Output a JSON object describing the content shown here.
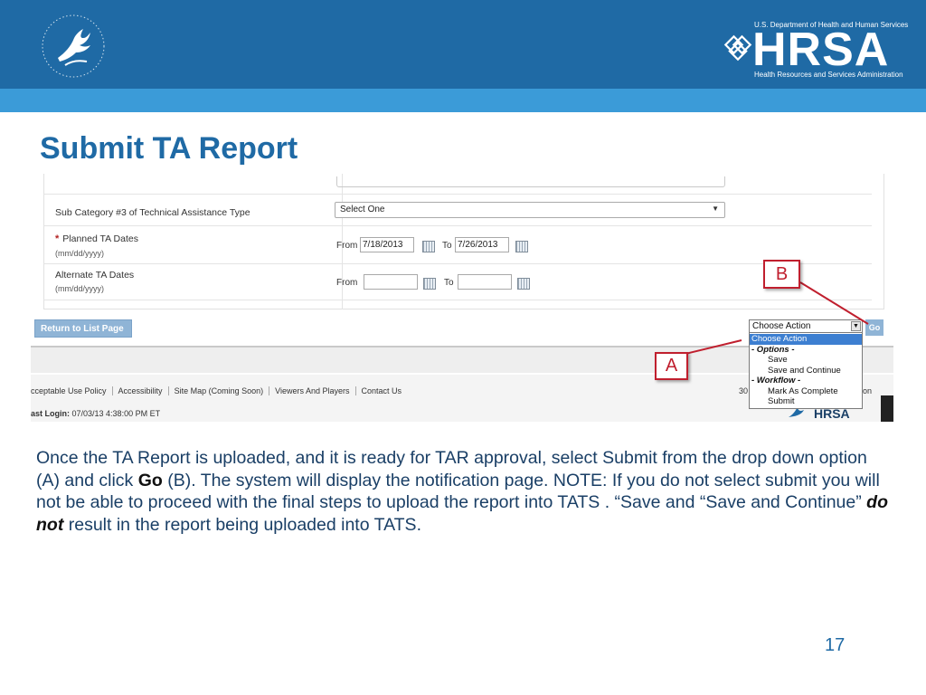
{
  "header": {
    "agency_line": "U.S. Department of Health and Human Services",
    "logo_word": "HRSA",
    "agency_full": "Health Resources and Services Administration",
    "colors": {
      "band": "#1f6aa5",
      "strip": "#3b9bd8",
      "accent": "#c01f2e"
    }
  },
  "slide": {
    "title": "Submit TA Report",
    "page_number": "17"
  },
  "form": {
    "sub_cat3_label": "Sub Category #3 of Technical Assistance Type",
    "sub_cat3_value": "Select One",
    "planned_label": "Planned TA Dates",
    "planned_hint": "(mm/dd/yyyy)",
    "planned_from_label": "From",
    "planned_from_value": "7/18/2013",
    "planned_to_label": "To",
    "planned_to_value": "7/26/2013",
    "alternate_label": "Alternate TA Dates",
    "alternate_hint": "(mm/dd/yyyy)",
    "alternate_from_label": "From",
    "alternate_from_value": "",
    "alternate_to_label": "To",
    "alternate_to_value": ""
  },
  "actions": {
    "return_button": "Return to List Page",
    "action_select_value": "Choose Action",
    "go_button": "Go",
    "dropdown": [
      {
        "label": "Choose Action",
        "kind": "highlighted"
      },
      {
        "label": "- Options -",
        "kind": "group"
      },
      {
        "label": "Save",
        "kind": "option"
      },
      {
        "label": "Save and Continue",
        "kind": "option"
      },
      {
        "label": "- Workflow -",
        "kind": "group"
      },
      {
        "label": "Mark As Complete",
        "kind": "option"
      },
      {
        "label": "Submit",
        "kind": "option"
      }
    ]
  },
  "footer": {
    "links": [
      "cceptable Use Policy",
      "Accessibility",
      "Site Map (Coming Soon)",
      "Viewers And Players",
      "Contact Us"
    ],
    "last_login_label": "ast Login:",
    "last_login_value": "07/03/13 4:38:00 PM ET",
    "fragment_left": "30",
    "fragment_right": "on",
    "mini_logo": "HRSA"
  },
  "callouts": {
    "a": "A",
    "b": "B"
  },
  "body": {
    "part1": "Once the TA Report is uploaded, and it is ready for TAR approval, select Submit from the drop down option (A) and click ",
    "go_bold": "Go",
    "part2": " (B). The system will display the notification page. NOTE: If you do not select submit you will not be able to proceed with the final steps to upload the report into TATS . “Save and “Save and Continue” ",
    "do_not": "do not",
    "part3": " result in the report being uploaded into TATS."
  }
}
